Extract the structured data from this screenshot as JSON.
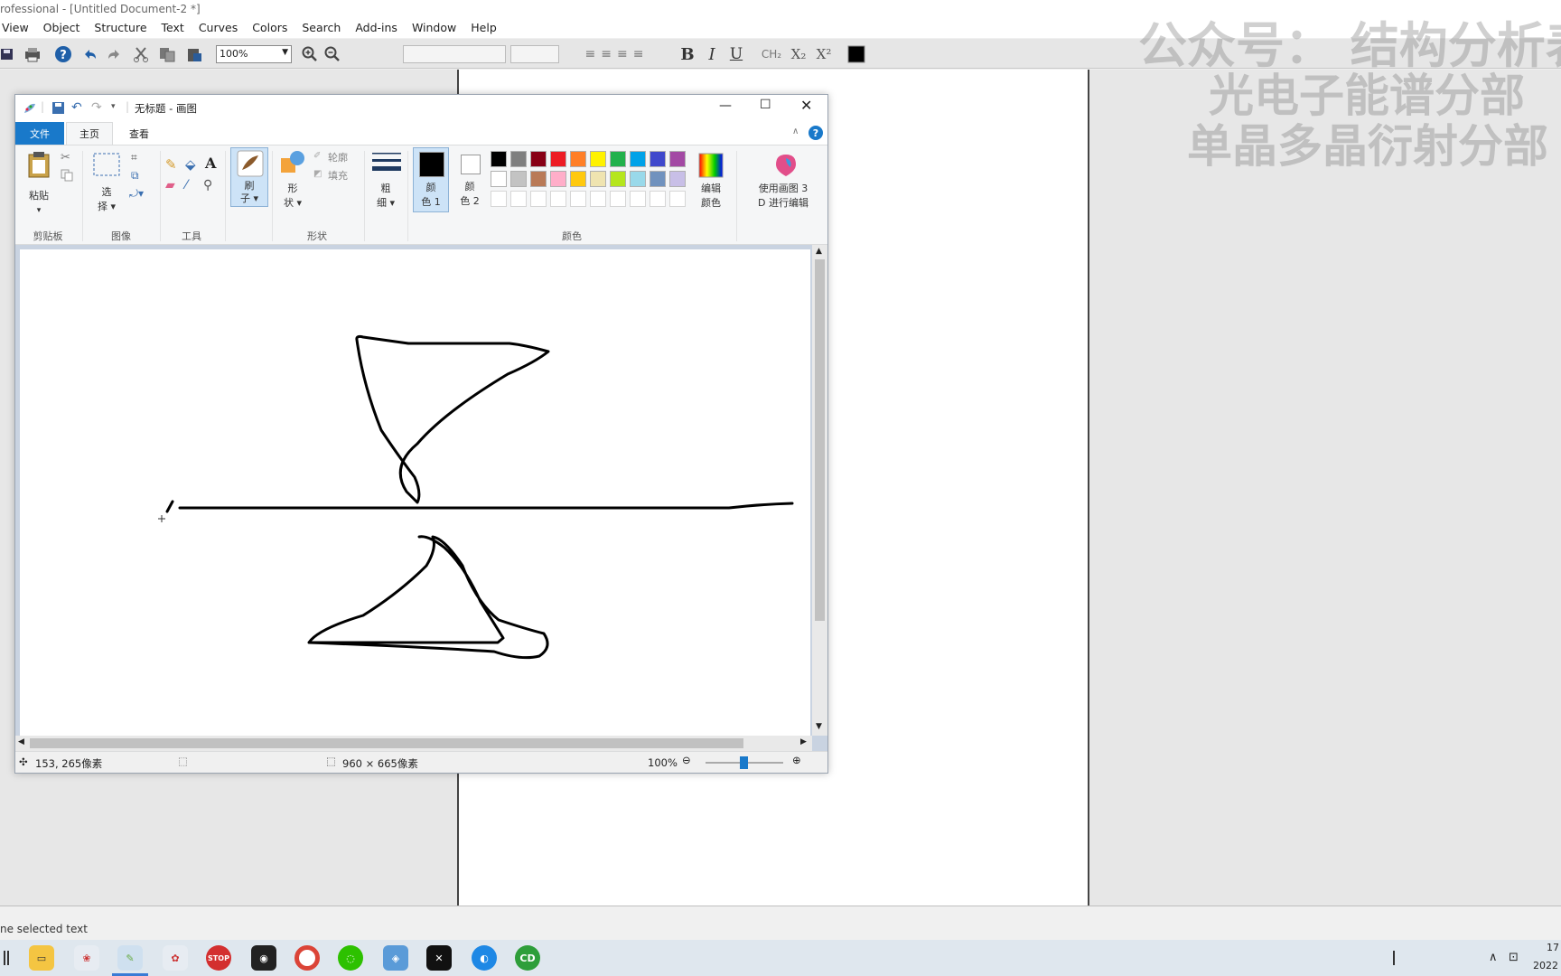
{
  "app": {
    "title": "rofessional - [Untitled Document-2 *]",
    "menu": [
      "View",
      "Object",
      "Structure",
      "Text",
      "Curves",
      "Colors",
      "Search",
      "Add-ins",
      "Window",
      "Help"
    ],
    "zoom": "100%",
    "status_text": "ne selected text"
  },
  "watermark": {
    "line1": "公众号：  结构分析表",
    "line2": "光电子能谱分部",
    "line3": "单晶多晶衍射分部"
  },
  "paint": {
    "title": "无标题 - 画图",
    "tabs": [
      "文件",
      "主页",
      "查看"
    ],
    "groups": {
      "clipboard": "剪贴板",
      "image": "图像",
      "tools": "工具",
      "shapes": "形状",
      "colors": "颜色"
    },
    "buttons": {
      "paste": "粘贴",
      "select_1": "选",
      "select_2": "择 ▾",
      "brush_1": "刷",
      "brush_2": "子 ▾",
      "shapes_1": "形",
      "shapes_2": "状 ▾",
      "outline": "轮廓",
      "fill": "填充",
      "size_1": "粗",
      "size_2": "细 ▾",
      "color1_1": "颜",
      "color1_2": "色 1",
      "color2_1": "颜",
      "color2_2": "色 2",
      "edit_colors_1": "编辑",
      "edit_colors_2": "颜色",
      "paint3d_1": "使用画图 3",
      "paint3d_2": "D 进行编辑"
    },
    "palette_row1": [
      "#000000",
      "#7f7f7f",
      "#880015",
      "#ed1c24",
      "#ff7f27",
      "#fff200",
      "#22b14c",
      "#00a2e8",
      "#3f48cc",
      "#a349a4"
    ],
    "palette_row2": [
      "#ffffff",
      "#c3c3c3",
      "#b97a57",
      "#ffaec9",
      "#ffc90e",
      "#efe4b0",
      "#b5e61d",
      "#99d9ea",
      "#7092be",
      "#c8bfe7"
    ],
    "status": {
      "cursor": "153, 265像素",
      "size": "960 × 665像素",
      "zoom": "100%"
    }
  },
  "taskbar": {
    "clock_1": "17",
    "clock_2": "2022"
  }
}
